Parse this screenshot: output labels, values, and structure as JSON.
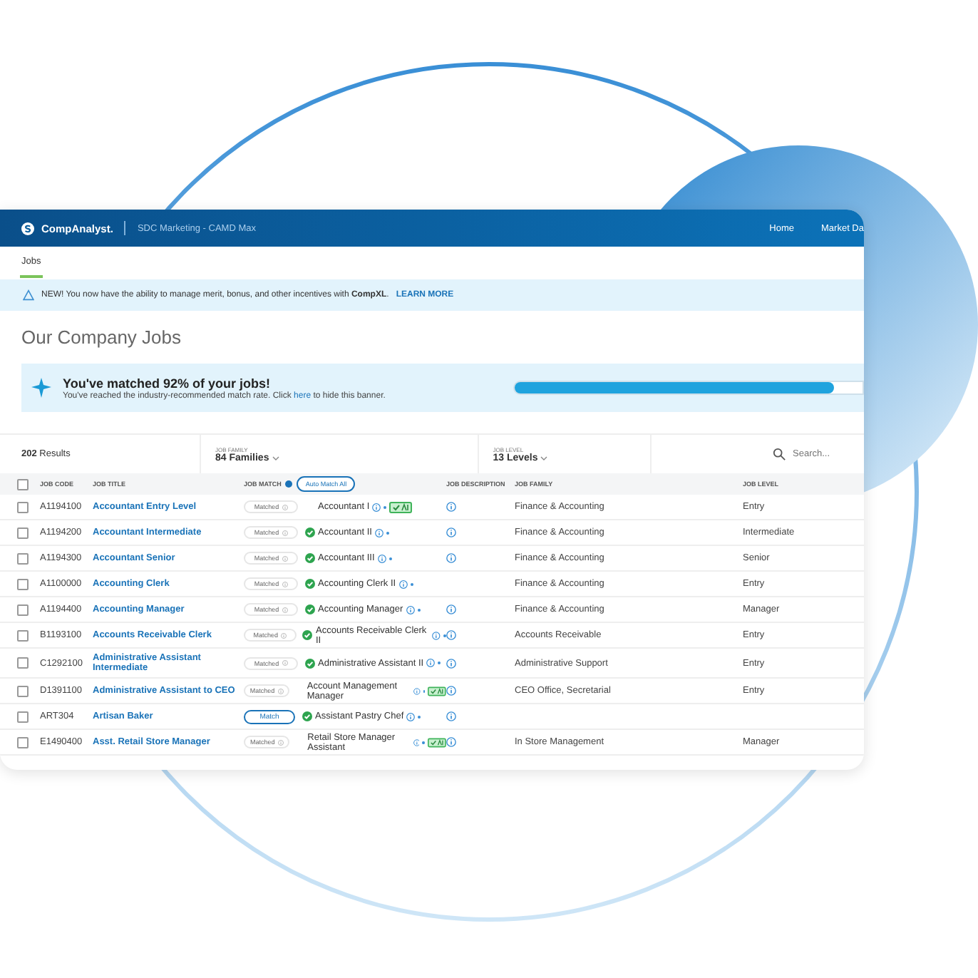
{
  "header": {
    "brand": "CompAnalyst.",
    "workspace": "SDC Marketing - CAMD Max",
    "nav": [
      "Home",
      "Market Da"
    ]
  },
  "tabs": [
    {
      "label": "Jobs",
      "selected": true
    }
  ],
  "notice": {
    "text": "NEW! You now have the ability to manage merit, bonus, and other incentives with **CompXL**.",
    "link": "LEARN MORE"
  },
  "page_title": "Our Company Jobs",
  "match_banner": {
    "title": "You've matched 92% of your jobs!",
    "text_before": "You've reached the industry-recommended match rate. Click",
    "link": "here",
    "text_after": "to hide this banner.",
    "level": 0.92
  },
  "filters": {
    "results": "**202** Results",
    "family": {
      "label": "JOB FAMILY",
      "value": "84 Families"
    },
    "level": {
      "label": "JOB LEVEL",
      "value": "13 Levels"
    },
    "search": {
      "placeholder": "Search..."
    }
  },
  "table": {
    "all_checked": false,
    "columns": [
      "JOB CODE",
      "JOB TITLE",
      "JOB MATCH",
      "JOB DESCRIPTION",
      "JOB FAMILY",
      "JOB LEVEL"
    ],
    "auto_match": "Auto Match All",
    "rows": [
      {
        "code": "A1194100",
        "title": "Accountant Entry Level",
        "match": {
          "kind": "matched",
          "label": "Matched"
        },
        "verified": false,
        "match_name": "Accountant I",
        "chip": true,
        "has_description": true,
        "family": "Finance & Accounting",
        "level": "Entry",
        "checked": false
      },
      {
        "code": "A1194200",
        "title": "Accountant Intermediate",
        "match": {
          "kind": "matched",
          "label": "Matched"
        },
        "verified": true,
        "match_name": "Accountant II",
        "chip": false,
        "has_description": true,
        "family": "Finance & Accounting",
        "level": "Intermediate",
        "checked": false
      },
      {
        "code": "A1194300",
        "title": "Accountant Senior",
        "match": {
          "kind": "matched",
          "label": "Matched"
        },
        "verified": true,
        "match_name": "Accountant III",
        "chip": false,
        "has_description": true,
        "family": "Finance & Accounting",
        "level": "Senior",
        "checked": false
      },
      {
        "code": "A1100000",
        "title": "Accounting Clerk",
        "match": {
          "kind": "matched",
          "label": "Matched"
        },
        "verified": true,
        "match_name": "Accounting Clerk II",
        "chip": false,
        "has_description": false,
        "family": "Finance & Accounting",
        "level": "Entry",
        "checked": false
      },
      {
        "code": "A1194400",
        "title": "Accounting Manager",
        "match": {
          "kind": "matched",
          "label": "Matched"
        },
        "verified": true,
        "match_name": "Accounting Manager",
        "chip": false,
        "has_description": true,
        "family": "Finance & Accounting",
        "level": "Manager",
        "checked": false
      },
      {
        "code": "B1193100",
        "title": "Accounts Receivable Clerk",
        "match": {
          "kind": "matched",
          "label": "Matched"
        },
        "verified": true,
        "match_name": "Accounts Receivable Clerk II",
        "chip": false,
        "has_description": true,
        "family": "Accounts Receivable",
        "level": "Entry",
        "checked": false
      },
      {
        "code": "C1292100",
        "title": "Administrative Assistant Intermediate",
        "match": {
          "kind": "matched",
          "label": "Matched"
        },
        "verified": true,
        "match_name": "Administrative Assistant II",
        "chip": false,
        "has_description": true,
        "family": "Administrative Support",
        "level": "Entry",
        "checked": false
      },
      {
        "code": "D1391100",
        "title": "Administrative Assistant to CEO",
        "match": {
          "kind": "matched",
          "label": "Matched"
        },
        "verified": false,
        "match_name": "Account Management Manager",
        "chip": true,
        "has_description": true,
        "family": "CEO Office, Secretarial",
        "level": "Entry",
        "checked": false
      },
      {
        "code": "ART304",
        "title": "Artisan Baker",
        "match": {
          "kind": "match",
          "label": "Match"
        },
        "verified": true,
        "match_name": "Assistant Pastry Chef",
        "chip": false,
        "has_description": true,
        "checked": false
      },
      {
        "code": "E1490400",
        "title": "Asst. Retail Store Manager",
        "match": {
          "kind": "matched",
          "label": "Matched"
        },
        "verified": false,
        "match_name": "Retail Store Manager Assistant",
        "chip": true,
        "has_description": true,
        "family": "In Store Management",
        "level": "Manager",
        "checked": false
      }
    ]
  }
}
